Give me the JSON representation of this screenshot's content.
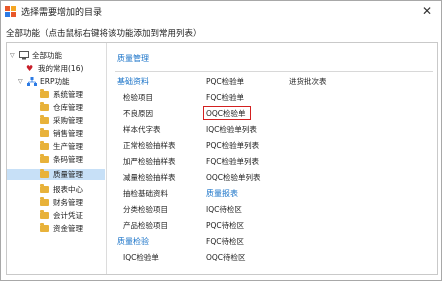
{
  "window": {
    "title": "选择需要增加的目录",
    "close_glyph": "✕"
  },
  "hint": "全部功能（点击鼠标右键将该功能添加到常用列表）",
  "tree": {
    "root": "全部功能",
    "favorites": "我的常用(16)",
    "erp": "ERP功能",
    "modules": [
      "系统管理",
      "仓库管理",
      "采购管理",
      "销售管理",
      "生产管理",
      "条码管理",
      "质量管理",
      "报表中心",
      "财务管理",
      "会计凭证",
      "资金管理"
    ],
    "selected_index": 6
  },
  "panel": {
    "title": "质量管理",
    "groups": {
      "basic": "基础资料",
      "report": "质量报表",
      "inspection": "质量检验"
    },
    "col1": [
      "检验项目",
      "不良原因",
      "样本代字表",
      "正常检验抽样表",
      "加严检验抽样表",
      "减量检验抽样表",
      "抽检基础资料",
      "分类检验项目",
      "产品检验项目"
    ],
    "col1_bottom": [
      "IQC检验单"
    ],
    "col2": [
      "PQC检验单",
      "FQC检验单",
      "OQC检验单",
      "IQC检验单列表",
      "PQC检验单列表",
      "FQC检验单列表",
      "OQC检验单列表"
    ],
    "col2_report": [
      "IQC待检区",
      "PQC待检区",
      "FQC待检区",
      "OQC待检区"
    ],
    "col3": [
      "进货批次表"
    ],
    "highlighted": "OQC检验单"
  },
  "colors": {
    "accent": "#1a73c8",
    "highlight": "#d32020",
    "selected_bg": "#c7e0f7",
    "folder": "#e8b23a"
  }
}
